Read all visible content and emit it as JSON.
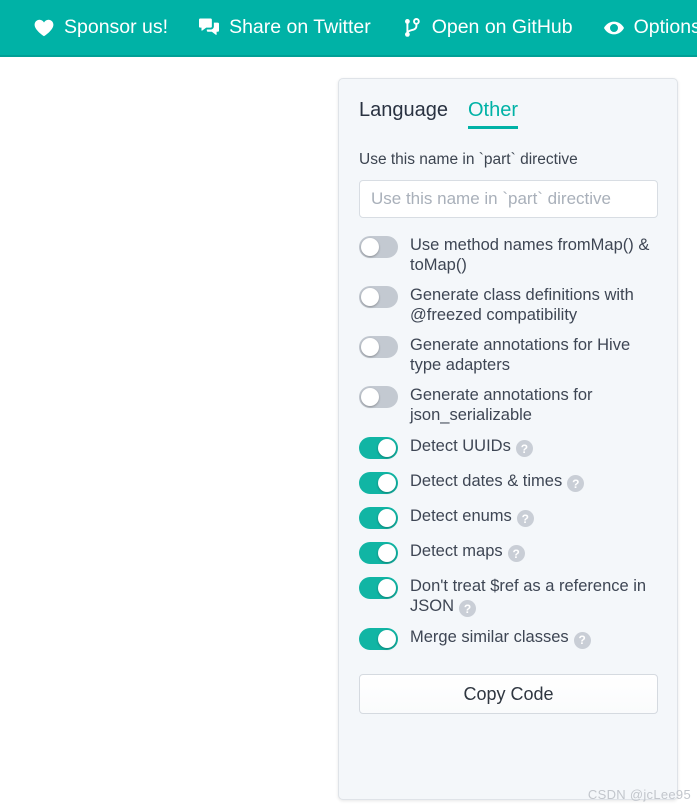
{
  "topbar": {
    "background_color": "#00b2a6",
    "items": [
      {
        "label": "Sponsor us!",
        "icon": "heart-icon"
      },
      {
        "label": "Share on Twitter",
        "icon": "comments-icon"
      },
      {
        "label": "Open on GitHub",
        "icon": "code-branch-icon"
      },
      {
        "label": "Options",
        "icon": "eye-icon"
      }
    ]
  },
  "panel": {
    "accent_color": "#00b2a6",
    "tabs": [
      {
        "label": "Language",
        "active": false
      },
      {
        "label": "Other",
        "active": true
      }
    ],
    "field": {
      "label": "Use this name in `part` directive",
      "placeholder": "Use this name in `part` directive",
      "value": ""
    },
    "options": [
      {
        "label": "Use method names fromMap() & toMap()",
        "on": false,
        "help": false
      },
      {
        "label": "Generate class definitions with @freezed compatibility",
        "on": false,
        "help": false
      },
      {
        "label": "Generate annotations for Hive type adapters",
        "on": false,
        "help": false
      },
      {
        "label": "Generate annotations for json_serializable",
        "on": false,
        "help": false
      },
      {
        "label": "Detect UUIDs",
        "on": true,
        "help": true
      },
      {
        "label": "Detect dates & times",
        "on": true,
        "help": true
      },
      {
        "label": "Detect enums",
        "on": true,
        "help": true
      },
      {
        "label": "Detect maps",
        "on": true,
        "help": true
      },
      {
        "label": "Don't treat $ref as a reference in JSON",
        "on": true,
        "help": true
      },
      {
        "label": "Merge similar classes",
        "on": true,
        "help": true
      }
    ],
    "copy_button": "Copy Code",
    "help_glyph": "?"
  },
  "watermark": "CSDN @jcLee95"
}
